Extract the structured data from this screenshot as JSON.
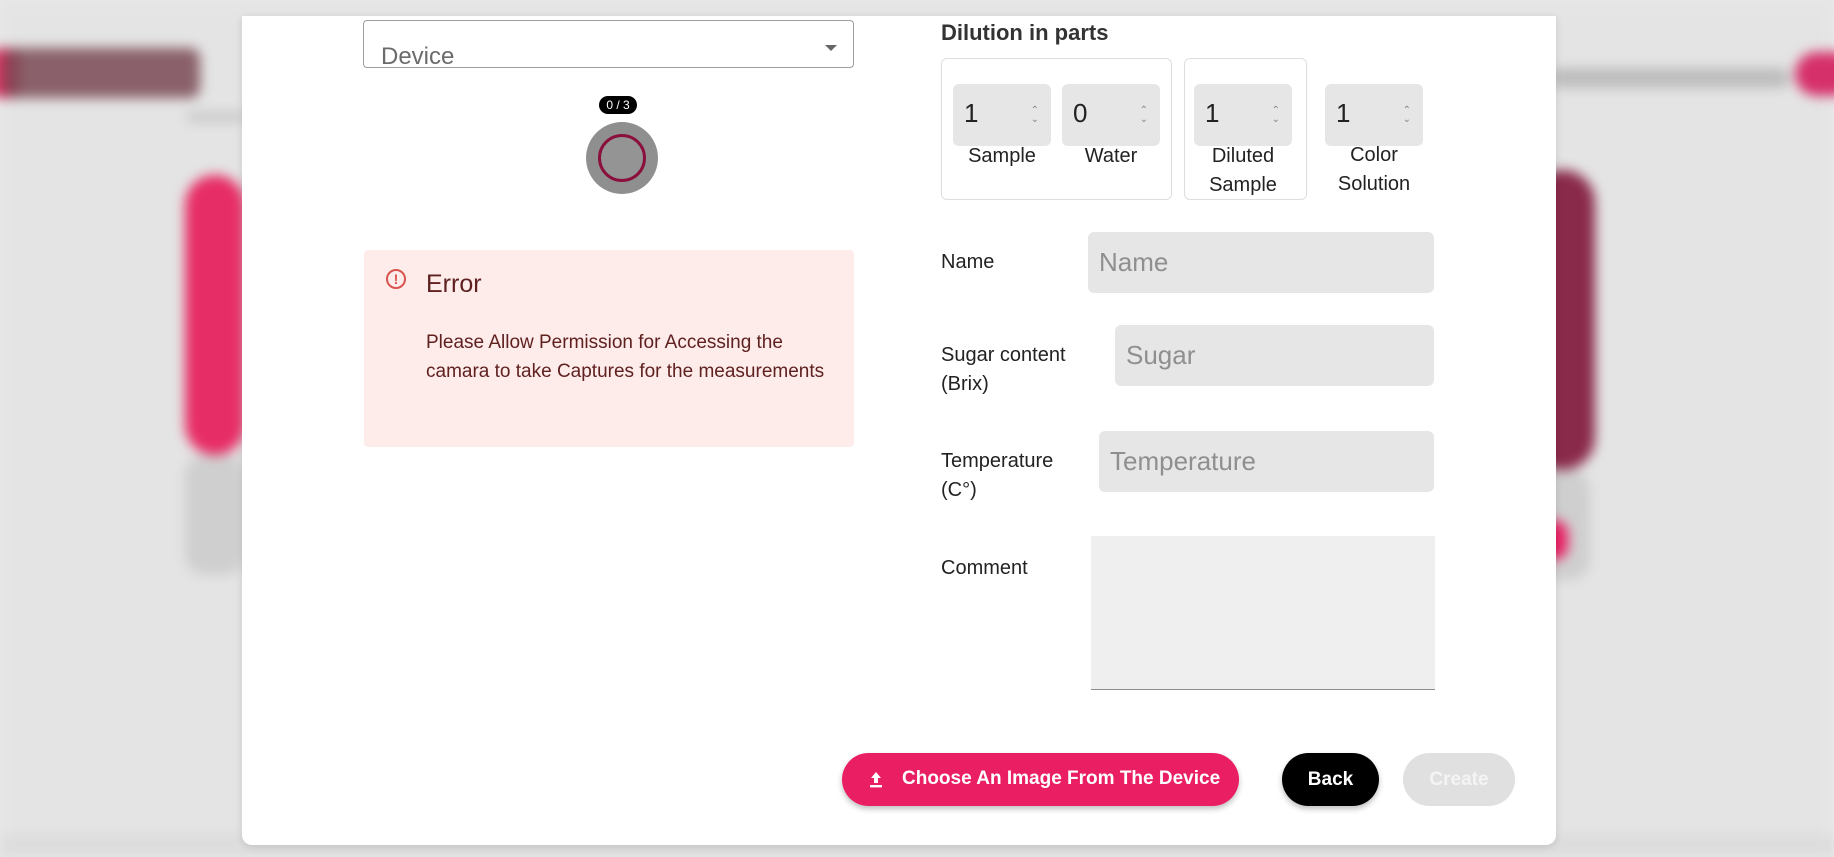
{
  "device_select": {
    "placeholder": "Device"
  },
  "capture": {
    "counter": "0 / 3"
  },
  "error": {
    "title": "Error",
    "message": "Please Allow Permission for Accessing the camara to take Captures for the measurements",
    "icon": "error-outline-icon",
    "color": "#5f2120",
    "background": "#fdecea"
  },
  "dilution": {
    "title": "Dilution in parts",
    "sample": {
      "value": "1",
      "label": "Sample"
    },
    "water": {
      "value": "0",
      "label": "Water"
    },
    "diluted_sample": {
      "value": "1",
      "label_line1": "Diluted",
      "label_line2": "Sample"
    },
    "color_solution": {
      "value": "1",
      "label_line1": "Color",
      "label_line2": "Solution"
    }
  },
  "form": {
    "name": {
      "label": "Name",
      "placeholder": "Name"
    },
    "sugar": {
      "label_line1": "Sugar content",
      "label_line2": "(Brix)",
      "placeholder": "Sugar"
    },
    "temperature": {
      "label_line1": "Temperature",
      "label_line2": "(C°)",
      "placeholder": "Temperature"
    },
    "comment": {
      "label": "Comment",
      "value": ""
    }
  },
  "actions": {
    "choose_image": "Choose An Image From The Device",
    "back": "Back",
    "create": "Create"
  },
  "colors": {
    "accent": "#e91e63",
    "capture_ring": "#8b0f3c",
    "disabled": "#e0e0e0"
  }
}
